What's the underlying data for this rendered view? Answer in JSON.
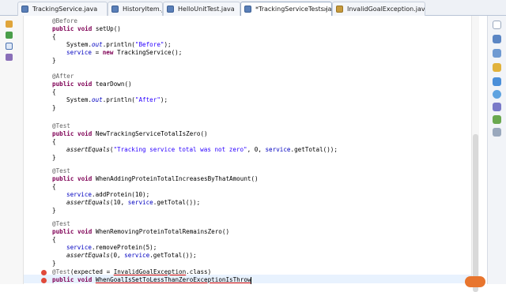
{
  "tabs": [
    {
      "label": "TrackingService.java",
      "active": false
    },
    {
      "label": "HistoryItem.java",
      "active": false
    },
    {
      "label": "HelloUnitTest.java",
      "active": false
    },
    {
      "label": "*TrackingServiceTests.java",
      "active": true
    },
    {
      "label": "InvalidGoalException.java",
      "active": false
    }
  ],
  "tab_close": "×",
  "code": {
    "l1": "@Before",
    "l2_kw": "public void",
    "l2_rest": " setUp()",
    "l3": "{",
    "l4_a": "System.",
    "l4_out": "out",
    "l4_b": ".println(",
    "l4_str": "\"Before\"",
    "l4_c": ");",
    "l5_fld": "service",
    "l5_a": " = ",
    "l5_kw": "new",
    "l5_b": " TrackingService();",
    "l6": "}",
    "l7": "@After",
    "l8_kw": "public void",
    "l8_rest": " tearDown()",
    "l9": "{",
    "l10_a": "System.",
    "l10_out": "out",
    "l10_b": ".println(",
    "l10_str": "\"After\"",
    "l10_c": ");",
    "l11": "}",
    "l12": "@Test",
    "l13_kw": "public void",
    "l13_rest": " NewTrackingServiceTotalIsZero()",
    "l14": "{",
    "l15_fn": "assertEquals",
    "l15_a": "(",
    "l15_str": "\"Tracking service total was not zero\"",
    "l15_b": ", 0, ",
    "l15_fld": "service",
    "l15_c": ".getTotal());",
    "l16": "}",
    "l17": "@Test",
    "l18_kw": "public void",
    "l18_rest": " WhenAddingProteinTotalIncreasesByThatAmount()",
    "l19": "{",
    "l20_fld": "service",
    "l20_a": ".addProtein(10);",
    "l21_fn": "assertEquals",
    "l21_a": "(10, ",
    "l21_fld": "service",
    "l21_b": ".getTotal());",
    "l22": "}",
    "l23": "@Test",
    "l24_kw": "public void",
    "l24_rest": " WhenRemovingProteinTotalRemainsZero()",
    "l25": "{",
    "l26_fld": "service",
    "l26_a": ".removeProtein(5);",
    "l27_fn": "assertEquals",
    "l27_a": "(0, ",
    "l27_fld": "service",
    "l27_b": ".getTotal());",
    "l28": "}",
    "l29_ann": "@Test",
    "l29_a": "(expected = ",
    "l29_u": "InvalidGoalException",
    "l29_b": ".class)",
    "l30_kw": "public void",
    "l30_sp": " ",
    "l30_u": "WhenGoalIsSetToLessThanZeroExceptionIsThrow"
  },
  "colors": {
    "keyword": "#7f0055",
    "annotation": "#646464",
    "string": "#2a00ff",
    "field": "#0000c0",
    "current_line": "#e8f2fe"
  },
  "gutter_icons": [
    "package-explorer-icon",
    "hierarchy-icon",
    "tasks-icon",
    "outline-icon",
    "search-icon"
  ],
  "right_icons": [
    "view-icon",
    "console-icon",
    "problems-icon",
    "javadoc-icon",
    "declaration-icon",
    "help-icon",
    "debug-icon",
    "junit-icon",
    "history-icon"
  ]
}
